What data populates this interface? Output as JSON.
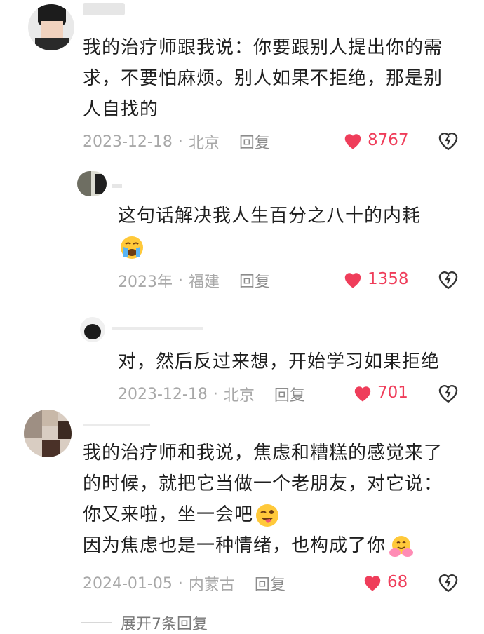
{
  "comments": [
    {
      "name": "",
      "text": "我的治疗师跟我说：你要跟别人提出你的需求，不要怕麻烦。别人如果不拒绝，那是别人自找的",
      "lines": [
        "我的治疗师跟我说：你要跟别人提出你的需",
        "求，不要怕麻烦。别人如果不拒绝，那是别",
        "人自找的"
      ],
      "date": "2023-12-18",
      "location": "北京",
      "reply": "回复",
      "likes": "8767",
      "replies": [
        {
          "name": "",
          "lines": [
            "这句话解决我人生百分之八十的内耗"
          ],
          "emoji": "loudly-crying-face",
          "date": "2023年",
          "location": "福建",
          "reply": "回复",
          "likes": "1358"
        },
        {
          "name": "",
          "lines": [
            "对，然后反过来想，开始学习如果拒绝"
          ],
          "date": "2023-12-18",
          "location": "北京",
          "reply": "回复",
          "likes": "701"
        }
      ]
    },
    {
      "name": "",
      "lines": [
        "我的治疗师和我说，焦虑和糟糕的感觉来了",
        "的时候，就把它当做一个老朋友，对它说：",
        "你又来啦，坐一会吧",
        "因为焦虑也是一种情绪，也构成了你"
      ],
      "emojis": [
        "winking-face-with-tongue",
        "hugging-face"
      ],
      "date": "2024-01-05",
      "location": "内蒙古",
      "reply": "回复",
      "likes": "68"
    }
  ],
  "expand_text": "展开7条回复",
  "colors": {
    "like": "#ef3d5a",
    "meta": "#a8a8a8",
    "text": "#1f1f1f"
  }
}
